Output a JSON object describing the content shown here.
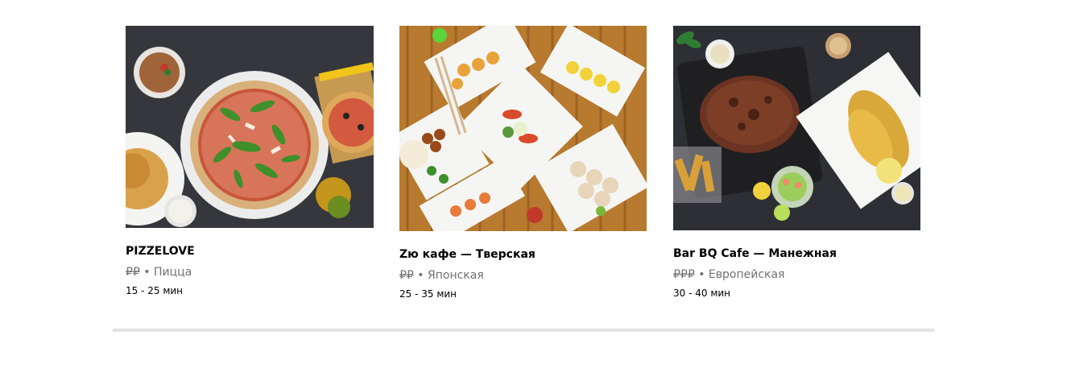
{
  "restaurants": [
    {
      "name": "PIZZELOVE",
      "price": "₽₽",
      "separator": "•",
      "cuisine": "Пицца",
      "delivery_time": "15 - 25 мин",
      "photo": "pizza-photo"
    },
    {
      "name": "Zю кафе — Тверская",
      "price": "₽₽",
      "separator": "•",
      "cuisine": "Японская",
      "delivery_time": "25 - 35 мин",
      "photo": "sushi-photo"
    },
    {
      "name": "Bar BQ Cafe — Манежная",
      "price": "₽₽₽",
      "separator": "•",
      "cuisine": "Европейская",
      "delivery_time": "30 - 40 мин",
      "photo": "steak-photo"
    }
  ],
  "colors": {
    "divider": "#e3e3e3",
    "meta_text": "#707070"
  }
}
